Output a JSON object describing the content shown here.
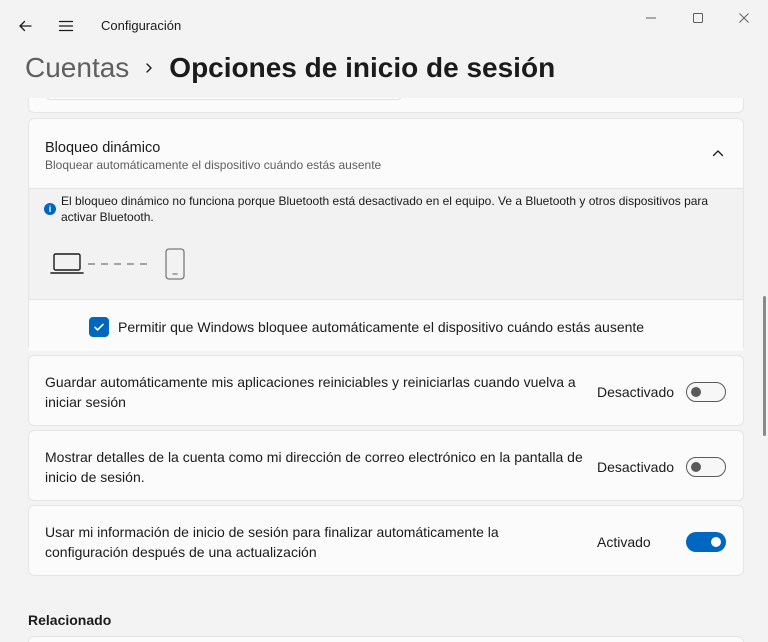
{
  "window": {
    "title": "Configuración"
  },
  "header": {
    "parent": "Cuentas",
    "current": "Opciones de inicio de sesión"
  },
  "dynamic_lock": {
    "title": "Bloqueo dinámico",
    "subtitle": "Bloquear automáticamente el dispositivo cuándo estás ausente",
    "info": "El bloqueo dinámico no funciona porque Bluetooth está desactivado en el equipo. Ve a Bluetooth y otros dispositivos para activar Bluetooth.",
    "checkbox_label": "Permitir que Windows bloquee automáticamente el dispositivo cuándo estás ausente",
    "checkbox_checked": true
  },
  "settings": [
    {
      "text": "Guardar automáticamente mis aplicaciones reiniciables y reiniciarlas cuando vuelva a iniciar sesión",
      "state": "Desactivado",
      "on": false
    },
    {
      "text": "Mostrar detalles de la cuenta como mi dirección de correo electrónico en la pantalla de inicio de sesión.",
      "state": "Desactivado",
      "on": false
    },
    {
      "text": "Usar mi información de inicio de sesión para finalizar automáticamente la configuración después de una actualización",
      "state": "Activado",
      "on": true
    }
  ],
  "related": {
    "title": "Relacionado"
  },
  "colors": {
    "accent": "#0067c0"
  }
}
